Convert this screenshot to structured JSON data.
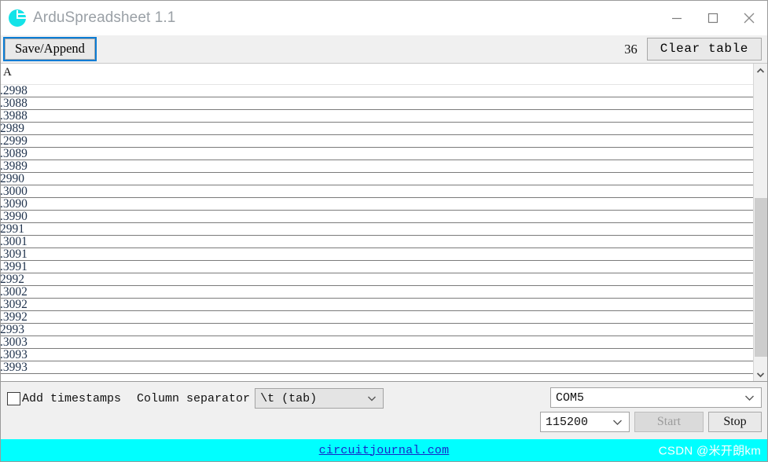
{
  "window": {
    "title": "ArduSpreadsheet 1.1",
    "icon": "arduspreadsheet-logo-icon",
    "controls": {
      "minimize": "minimize-icon",
      "maximize": "maximize-icon",
      "close": "close-icon"
    }
  },
  "toolbar": {
    "save_label": "Save/Append",
    "row_count": "36",
    "clear_label": "Clear table"
  },
  "table": {
    "columns": [
      "A"
    ],
    "rows": [
      ".2998",
      ".3088",
      ".3988",
      "2989",
      ".2999",
      ".3089",
      ".3989",
      "2990",
      ".3000",
      ".3090",
      ".3990",
      "2991",
      ".3001",
      ".3091",
      ".3991",
      "2992",
      ".3002",
      ".3092",
      ".3992",
      "2993",
      ".3003",
      ".3093",
      ".3993"
    ]
  },
  "scrollbar": {
    "up_arrow": "chevron-up-icon",
    "down_arrow": "chevron-down-icon"
  },
  "options": {
    "timestamps_label": "Add timestamps",
    "timestamps_checked": false,
    "separator_label": "Column separator",
    "separator_value": "\\t (tab)"
  },
  "serial": {
    "port_value": "COM5",
    "baud_value": "115200",
    "start_label": "Start",
    "start_enabled": false,
    "stop_label": "Stop",
    "stop_enabled": true
  },
  "footer": {
    "link_text": "circuitjournal.com",
    "watermark": "CSDN @米开朗km"
  },
  "colors": {
    "accent": "#00FFFF",
    "focus_border": "#0b7cd4",
    "panel": "#f0f0f0",
    "link": "#1727c8"
  }
}
